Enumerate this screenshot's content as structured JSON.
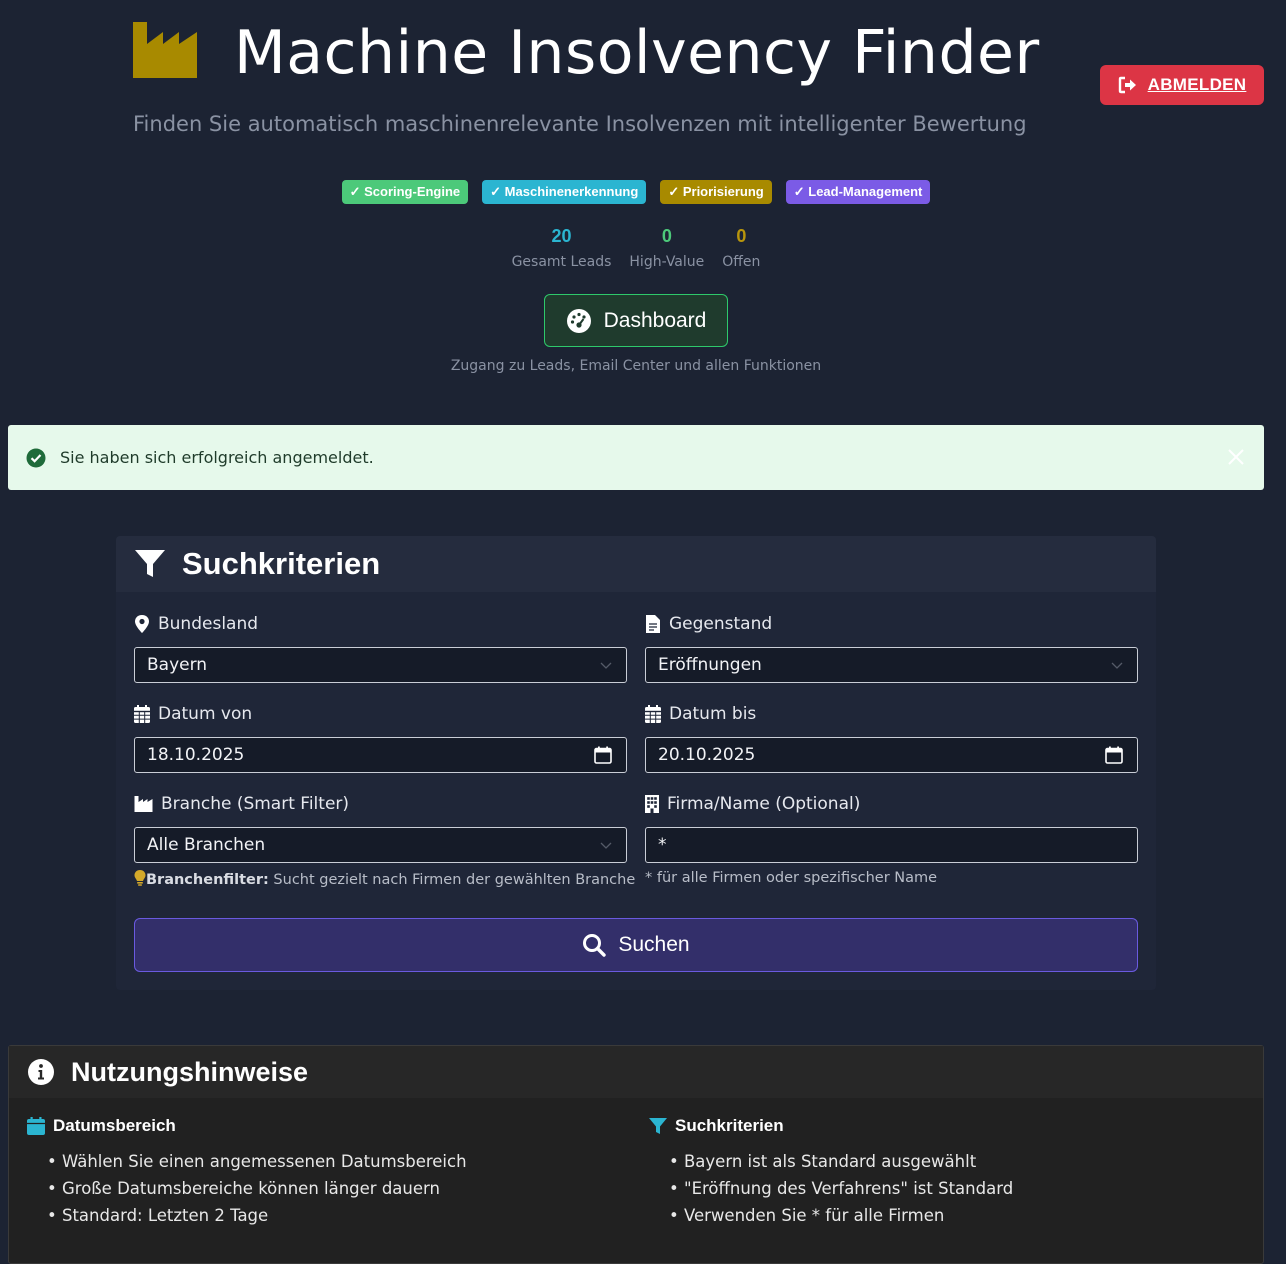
{
  "header": {
    "icon": "industry-icon",
    "title": "Machine Insolvency Finder",
    "subtitle": "Finden Sie automatisch maschinenrelevante Insolvenzen mit intelligenter Bewertung",
    "logout_label": "ABMELDEN"
  },
  "badges": [
    {
      "label": "✓ Scoring-Engine",
      "color": "#4cc97a"
    },
    {
      "label": "✓ Maschinenerkennung",
      "color": "#2bb5d1"
    },
    {
      "label": "✓ Priorisierung",
      "color": "#a88a00"
    },
    {
      "label": "✓ Lead-Management",
      "color": "#7b5be6"
    }
  ],
  "stats": [
    {
      "value": "20",
      "label": "Gesamt Leads",
      "color": "#2bb5d1"
    },
    {
      "value": "0",
      "label": "High-Value",
      "color": "#4cc97a"
    },
    {
      "value": "0",
      "label": "Offen",
      "color": "#b8950c"
    }
  ],
  "dashboard": {
    "label": "Dashboard",
    "subtext": "Zugang zu Leads, Email Center und allen Funktionen"
  },
  "alert": {
    "message": "Sie haben sich erfolgreich angemeldet."
  },
  "search": {
    "title": "Suchkriterien",
    "bundesland_label": "Bundesland",
    "bundesland_value": "Bayern",
    "gegenstand_label": "Gegenstand",
    "gegenstand_value": "Eröffnungen",
    "datum_von_label": "Datum von",
    "datum_von_value": "18.10.2025",
    "datum_bis_label": "Datum bis",
    "datum_bis_value": "20.10.2025",
    "branche_label": "Branche (Smart Filter)",
    "branche_value": "Alle Branchen",
    "branche_hint_bold": "Branchenfilter:",
    "branche_hint": " Sucht gezielt nach Firmen der gewählten Branche",
    "firma_label": "Firma/Name (Optional)",
    "firma_value": "*",
    "firma_hint": "* für alle Firmen oder spezifischer Name",
    "submit_label": "Suchen"
  },
  "usage": {
    "title": "Nutzungshinweise",
    "col1_title": "Datumsbereich",
    "col1_items": [
      "Wählen Sie einen angemessenen Datumsbereich",
      "Große Datumsbereiche können länger dauern",
      "Standard: Letzten 2 Tage"
    ],
    "col2_title": "Suchkriterien",
    "col2_items": [
      "Bayern ist als Standard ausgewählt",
      "\"Eröffnung des Verfahrens\" ist Standard",
      "Verwenden Sie * für alle Firmen"
    ]
  },
  "colors": {
    "background": "#1c2333",
    "logout": "#dc3545",
    "dashboard_border": "#2ec96b",
    "search_button_border": "#6a5ae0",
    "alert_bg": "#e6f9eb",
    "icon_yellow": "#a88a00",
    "icon_cyan": "#2bb5d1"
  }
}
